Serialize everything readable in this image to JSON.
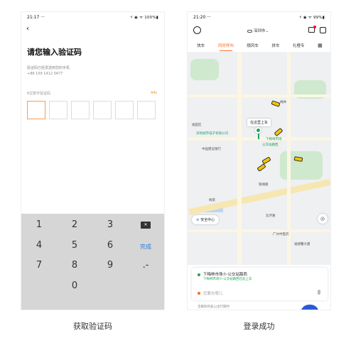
{
  "left": {
    "status": {
      "time": "21:17 ···",
      "icons": "⚡ ◉ ᯤ 100%▮"
    },
    "back_glyph": "‹",
    "title": "请您输入验证码",
    "hint": "验证码已经发送到您的手机",
    "phone": "+86 159 1412 0477",
    "code_prompt": "6位数字验证码",
    "countdown": "44s",
    "keypad": {
      "k1": "1",
      "k2": "2",
      "k3": "3",
      "k4": "4",
      "k5": "5",
      "k6": "6",
      "k7": "7",
      "k8": "8",
      "k9": "9",
      "k0": "0",
      "done": "完成",
      "dot": ".-",
      "del": "✕"
    },
    "caption": "获取验证码"
  },
  "right": {
    "status": {
      "time": "21:20 ···",
      "icons": "⚡ ◉ ᯤ 99%▮"
    },
    "city": "深圳市⌄",
    "tabs": [
      "快车",
      "同时呼叫",
      "顺风车",
      "拼车",
      "礼橙专"
    ],
    "map": {
      "pin_label": "在这里上车",
      "poi_1": "深圳城市电子有限公司",
      "poi_2": "下梅林市场",
      "poi_3": "公交站路西",
      "poi_4": "中国建设银行",
      "poi_5": "梅林",
      "poi_6": "银湖路",
      "poi_7": "广州中医药",
      "poi_8": "福德馨大厦",
      "poi_9": "北环路",
      "poi_10": "梅景",
      "poi_11": "福田区"
    },
    "safety_label": "安全中心",
    "trip": {
      "from": "下梅林市场⑦-公交站路西",
      "from_sub": "下梅林市场⑦-公交站路西在此上车",
      "to_placeholder": "您要去哪儿"
    },
    "promo": "宝箱你的安心出行随时",
    "caption": "登录成功"
  }
}
